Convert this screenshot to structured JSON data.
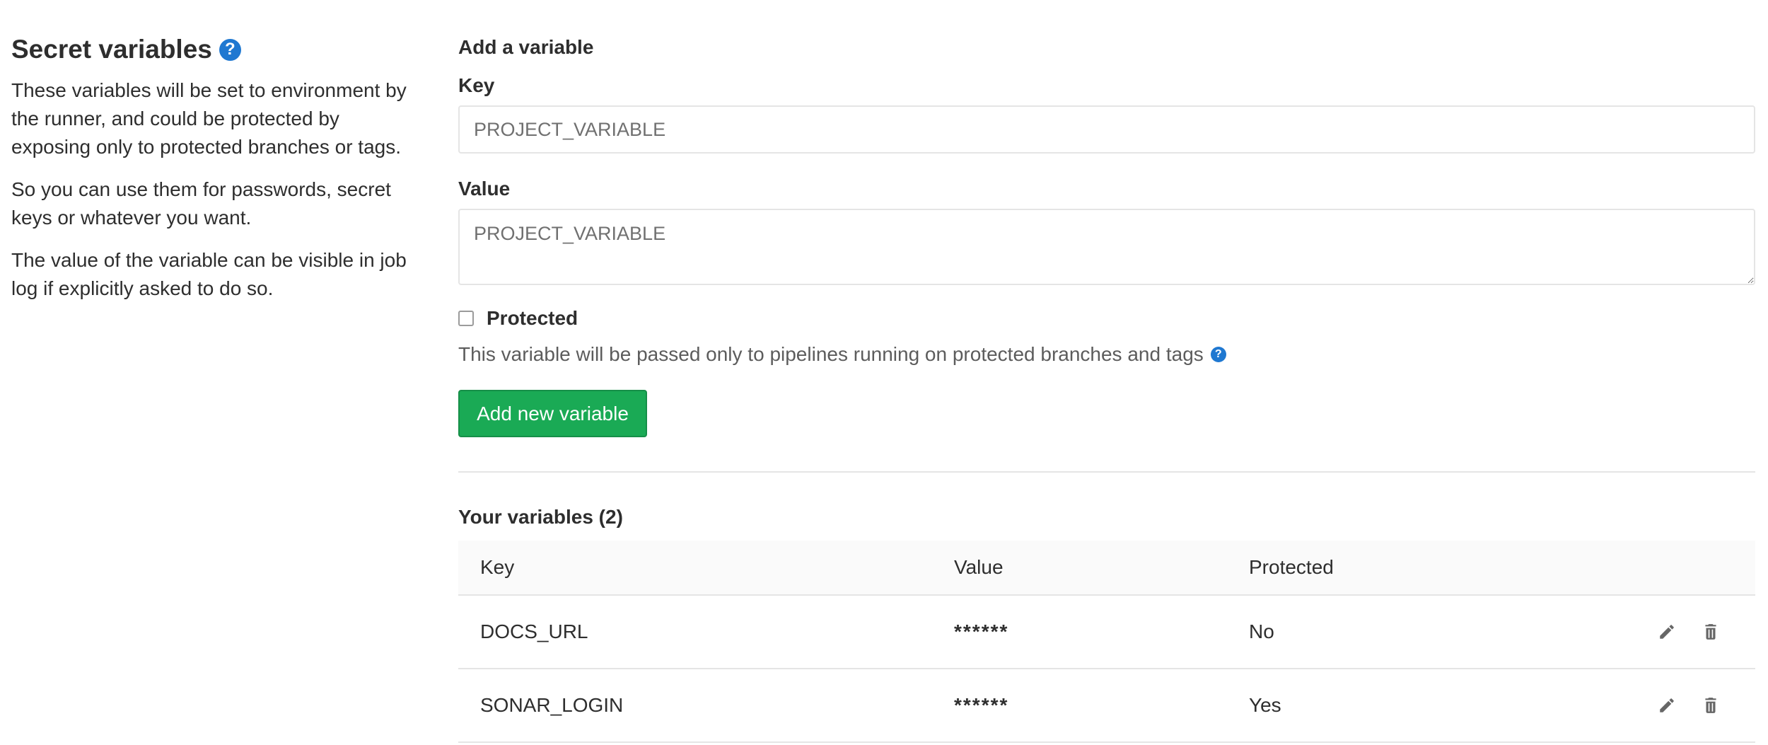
{
  "intro": {
    "title": "Secret variables",
    "help_glyph": "?",
    "paragraphs": [
      "These variables will be set to environment by the runner, and could be protected by exposing only to protected branches or tags.",
      "So you can use them for passwords, secret keys or whatever you want.",
      "The value of the variable can be visible in job log if explicitly asked to do so."
    ]
  },
  "form": {
    "heading": "Add a variable",
    "key_label": "Key",
    "key_placeholder": "PROJECT_VARIABLE",
    "value_label": "Value",
    "value_placeholder": "PROJECT_VARIABLE",
    "protected_label": "Protected",
    "protected_checked": false,
    "protected_help": "This variable will be passed only to pipelines running on protected branches and tags",
    "help_glyph": "?",
    "submit_label": "Add new variable"
  },
  "variables": {
    "heading": "Your variables (2)",
    "columns": {
      "key": "Key",
      "value": "Value",
      "protected": "Protected"
    },
    "rows": [
      {
        "key": "DOCS_URL",
        "value": "******",
        "protected": "No"
      },
      {
        "key": "SONAR_LOGIN",
        "value": "******",
        "protected": "Yes"
      }
    ]
  },
  "icons": {
    "help": "question-circle-icon",
    "edit": "pencil-icon",
    "delete": "trash-icon"
  },
  "colors": {
    "primary_green": "#1aaa55",
    "help_blue": "#1f78d1",
    "border": "#e5e5e5"
  }
}
